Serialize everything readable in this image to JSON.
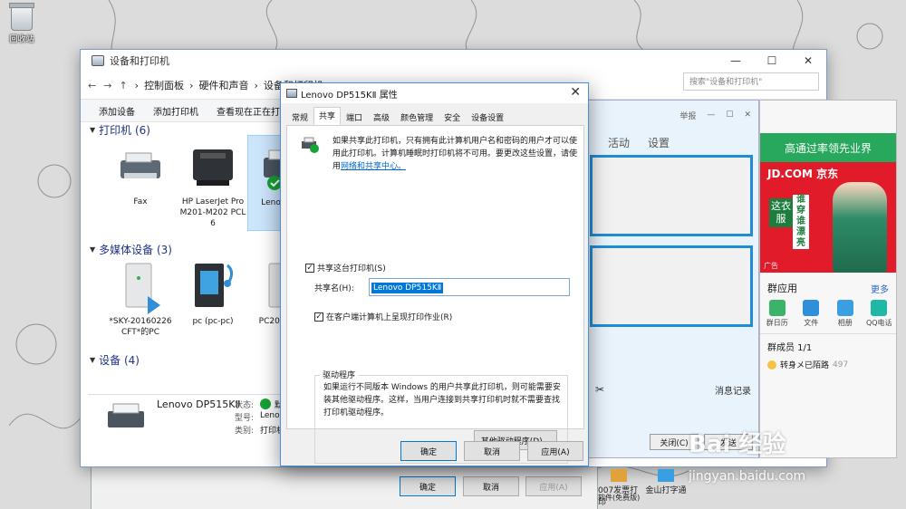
{
  "desktop": {
    "recycle_bin_label": "回收站"
  },
  "explorer": {
    "title": "设备和打印机",
    "window_controls": [
      "—",
      "☐",
      "✕"
    ],
    "breadcrumb": [
      "控制面板",
      "硬件和声音",
      "设备和打印机"
    ],
    "search_placeholder": "搜索\"设备和打印机\"",
    "toolbar": {
      "add_device": "添加设备",
      "add_printer": "添加打印机",
      "view_printing": "查看现在正在打印"
    },
    "groups": {
      "printers": "打印机 (6)",
      "multimedia": "多媒体设备 (3)",
      "devices": "设备 (4)"
    },
    "printers": [
      {
        "name": "Fax"
      },
      {
        "name": "HP LaserJet Pro M201-M202 PCL 6"
      },
      {
        "name": "Lenovo D Ⅱ"
      }
    ],
    "media_devices": [
      {
        "name": "*SKY-20160226 CFT*的PC"
      },
      {
        "name": "pc (pc-pc)"
      },
      {
        "name": "PC201512 8"
      }
    ],
    "details": {
      "name": "Lenovo DP515KⅡ",
      "status_label": "状态:",
      "status_value": "默认",
      "model_label": "型号:",
      "model_value": "Lenovo",
      "category_label": "类别:",
      "category_value": "打印机"
    }
  },
  "dialog": {
    "title": "Lenovo DP515KⅡ 属性",
    "tabs": [
      "常规",
      "共享",
      "端口",
      "高级",
      "颜色管理",
      "安全",
      "设备设置"
    ],
    "active_tab": "共享",
    "info_text": "如果共享此打印机，只有拥有此计算机用户名和密码的用户才可以使用此打印机。计算机睡眠时打印机将不可用。要更改这些设置，请使用",
    "info_link": "网络和共享中心。",
    "share_checkbox": "共享这台打印机(S)",
    "share_name_label": "共享名(H):",
    "share_name_value": "Lenovo DP515KⅡ",
    "render_checkbox": "在客户端计算机上呈现打印作业(R)",
    "drivers_title": "驱动程序",
    "drivers_text": "如果运行不同版本 Windows 的用户共享此打印机，则可能需要安装其他驱动程序。这样，当用户连接到共享打印机时就不需要查找打印机驱动程序。",
    "other_drivers_button": "其他驱动程序(D)...",
    "ok_button": "确定",
    "cancel_button": "取消",
    "apply_button": "应用(A)"
  },
  "ghost_dialog": {
    "ok_button": "确定",
    "cancel_button": "取消",
    "apply_button": "应用(A)"
  },
  "qqchat": {
    "top_label": "举报",
    "tabs": [
      "活动",
      "设置"
    ],
    "message_history": "消息记录",
    "close_button": "关闭(C)",
    "send_button": "发送"
  },
  "qq": {
    "ad_banner": "高通过率领先业界",
    "jd": "JD.COM 京东",
    "slogan": "这衣服",
    "slogan2": "谁穿谁漂亮",
    "ad_tag": "广告",
    "apps_title": "群应用",
    "more": "更多",
    "apps": [
      "群日历",
      "文件",
      "相册",
      "QQ电话"
    ],
    "members_title": "群成员 1/1",
    "member_name": "转身メ已陌路",
    "member_suffix": "497"
  },
  "taskbar": {
    "items": [
      "007发票打印",
      "金山打字通"
    ],
    "subtext": "软件(免费版)"
  },
  "watermark": {
    "logo": "Bai 经验",
    "url": "jingyan.baidu.com"
  },
  "colors": {
    "accent": "#0078d7",
    "qq_green": "#27a85c",
    "jd_red": "#e21b2a",
    "check_green": "#18a135"
  }
}
